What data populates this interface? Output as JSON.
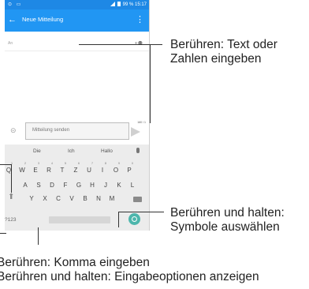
{
  "statusbar": {
    "battery": "99 %",
    "time": "15:17"
  },
  "toolbar": {
    "title": "Neue Mitteilung"
  },
  "to_field": {
    "label": "An"
  },
  "compose": {
    "placeholder": "Mitteilung senden",
    "counter": "160 / 1"
  },
  "keyboard": {
    "suggestions": [
      "Die",
      "Ich",
      "Hallo"
    ],
    "row1": [
      "Q",
      "W",
      "E",
      "R",
      "T",
      "Z",
      "U",
      "I",
      "O",
      "P"
    ],
    "row1_hints": [
      "1",
      "2",
      "3",
      "4",
      "5",
      "6",
      "7",
      "8",
      "9",
      "0"
    ],
    "row2": [
      "A",
      "S",
      "D",
      "F",
      "G",
      "H",
      "J",
      "K",
      "L"
    ],
    "row3": [
      "Y",
      "X",
      "C",
      "V",
      "B",
      "N",
      "M"
    ],
    "symbols_key": "?123"
  },
  "annotations": {
    "text_input": [
      "Berühren: Text oder",
      "Zahlen eingeben"
    ],
    "symbols": [
      "Berühren und halten:",
      "Symbole auswählen"
    ],
    "comma": [
      "Berühren: Komma eingeben",
      "Berühren und halten: Eingabeoptionen anzeigen"
    ]
  }
}
